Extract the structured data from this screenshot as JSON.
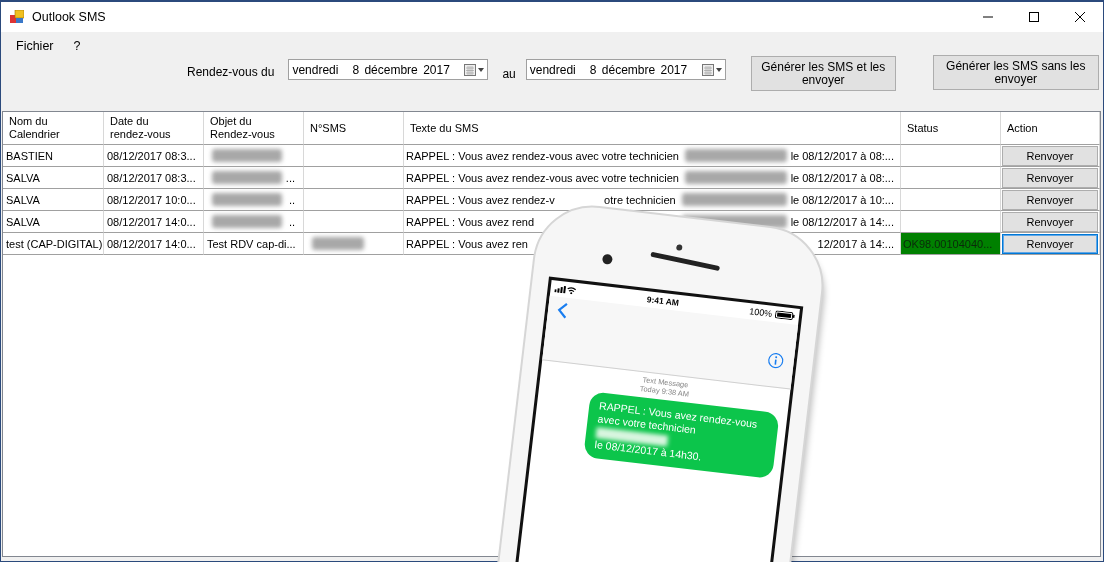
{
  "window": {
    "title": "Outlook SMS"
  },
  "menu": [
    {
      "label": "Fichier"
    },
    {
      "label": "?"
    }
  ],
  "filters": {
    "from_label": "Rendez-vous du",
    "from": {
      "weekday": "vendredi",
      "date": "8 décembre 2017"
    },
    "to_label": "au",
    "to": {
      "weekday": "vendredi",
      "date": "8 décembre 2017"
    }
  },
  "buttons": [
    {
      "label": "Générer les SMS et les envoyer"
    },
    {
      "label": "Générer les SMS sans les envoyer"
    }
  ],
  "table": {
    "columns": [
      "Nom du Calendrier",
      "Date du rendez-vous",
      "Objet du Rendez-vous",
      "N°SMS",
      "Texte du SMS",
      "Status",
      "Action"
    ],
    "rows": [
      {
        "calendar": "BASTIEN",
        "date": "08/12/2017 08:3...",
        "subject": {
          "redacted": true
        },
        "sms_no": {},
        "sms": {
          "start": "RAPPEL : Vous avez rendez-vous avec votre technicien",
          "redacted": true,
          "end": "le 08/12/2017 à 08:..."
        },
        "action": "Renvoyer",
        "selected": false
      },
      {
        "calendar": "SALVA",
        "date": "08/12/2017 08:3...",
        "subject": {
          "redacted": true,
          "suffix": "..."
        },
        "sms_no": {},
        "sms": {
          "start": "RAPPEL : Vous avez rendez-vous avec votre technicien",
          "redacted": true,
          "end": "le 08/12/2017 à 08:..."
        },
        "action": "Renvoyer",
        "selected": false
      },
      {
        "calendar": "SALVA",
        "date": "08/12/2017 10:0...",
        "subject": {
          "redacted": true,
          "suffix": ".."
        },
        "sms_no": {},
        "sms": {
          "start": "RAPPEL : Vous avez rendez-v",
          "middle": "otre technicien",
          "redacted": true,
          "end": "le 08/12/2017 à 10:..."
        },
        "action": "Renvoyer",
        "selected": false
      },
      {
        "calendar": "SALVA",
        "date": "08/12/2017 14:0...",
        "subject": {
          "redacted": true,
          "suffix": ".."
        },
        "sms_no": {},
        "sms": {
          "start": "RAPPEL : Vous avez rend",
          "redacted": true,
          "end": "le 08/12/2017 à 14:..."
        },
        "action": "Renvoyer",
        "selected": false
      },
      {
        "calendar": "test (CAP-DIGITAL)",
        "date": "08/12/2017 14:0...",
        "subject": {
          "text": "Test RDV cap-di..."
        },
        "sms_no": {
          "redacted": true
        },
        "sms": {
          "start": "RAPPEL : Vous avez ren",
          "end": "12/2017 à 14:..."
        },
        "status": {
          "text": "OK98.00104040...",
          "color": "#008000"
        },
        "action": "Renvoyer",
        "selected": true
      }
    ]
  },
  "phone": {
    "time": "9:41 AM",
    "battery": "100%",
    "thread_label": "Text Message",
    "thread_time": "Today 9:38 AM",
    "message": {
      "start": "RAPPEL : Vous avez rendez-vous avec votre technicien",
      "redacted": true,
      "end": "le 08/12/2017 à 14h30."
    }
  }
}
